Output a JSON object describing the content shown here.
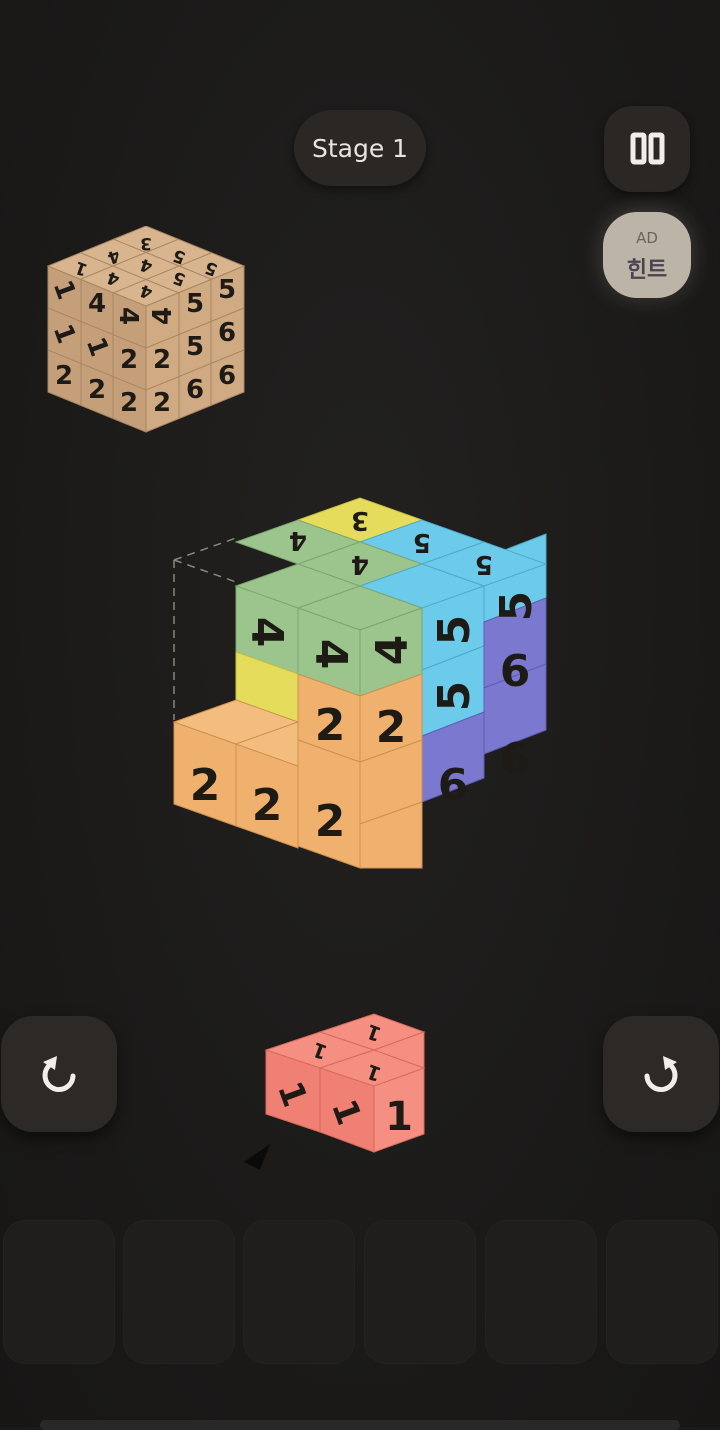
{
  "header": {
    "stage_label": "Stage 1",
    "pause_icon": "pause-icon"
  },
  "hint": {
    "ad_label": "AD",
    "hint_label": "힌트"
  },
  "controls": {
    "rotate_left_icon": "rotate-counterclockwise-icon",
    "rotate_right_icon": "rotate-clockwise-icon"
  },
  "target_cube": {
    "left_face": [
      "1",
      "4",
      "4",
      "1",
      "1",
      "2",
      "2",
      "2",
      "2"
    ],
    "right_face": [
      "4",
      "5",
      "5",
      "2",
      "5",
      "6",
      "2",
      "6",
      "6"
    ],
    "top_face": [
      "3",
      "4",
      "1",
      "5",
      "4",
      "4",
      "5",
      "5",
      "4"
    ]
  },
  "board": {
    "top_row": [
      "4",
      "3",
      "4",
      "5",
      "5"
    ],
    "left_face": [
      "4",
      "4",
      "2",
      "2",
      "2",
      "2"
    ],
    "right_face": [
      "4",
      "5",
      "5",
      "5",
      "6",
      "2",
      "6",
      "6"
    ]
  },
  "current_piece": {
    "digits": [
      "1",
      "1",
      "1",
      "1",
      "1",
      "1"
    ]
  },
  "tray_slots": [
    "",
    "",
    "",
    "",
    "",
    ""
  ],
  "colors": {
    "background": "#1b1a19",
    "tan": "#c9a27a",
    "green": "#9bc58c",
    "yellow": "#e6dc5c",
    "orange": "#f0b06e",
    "blue": "#6ccbeb",
    "purple": "#7b78cf",
    "red": "#f07f74"
  }
}
